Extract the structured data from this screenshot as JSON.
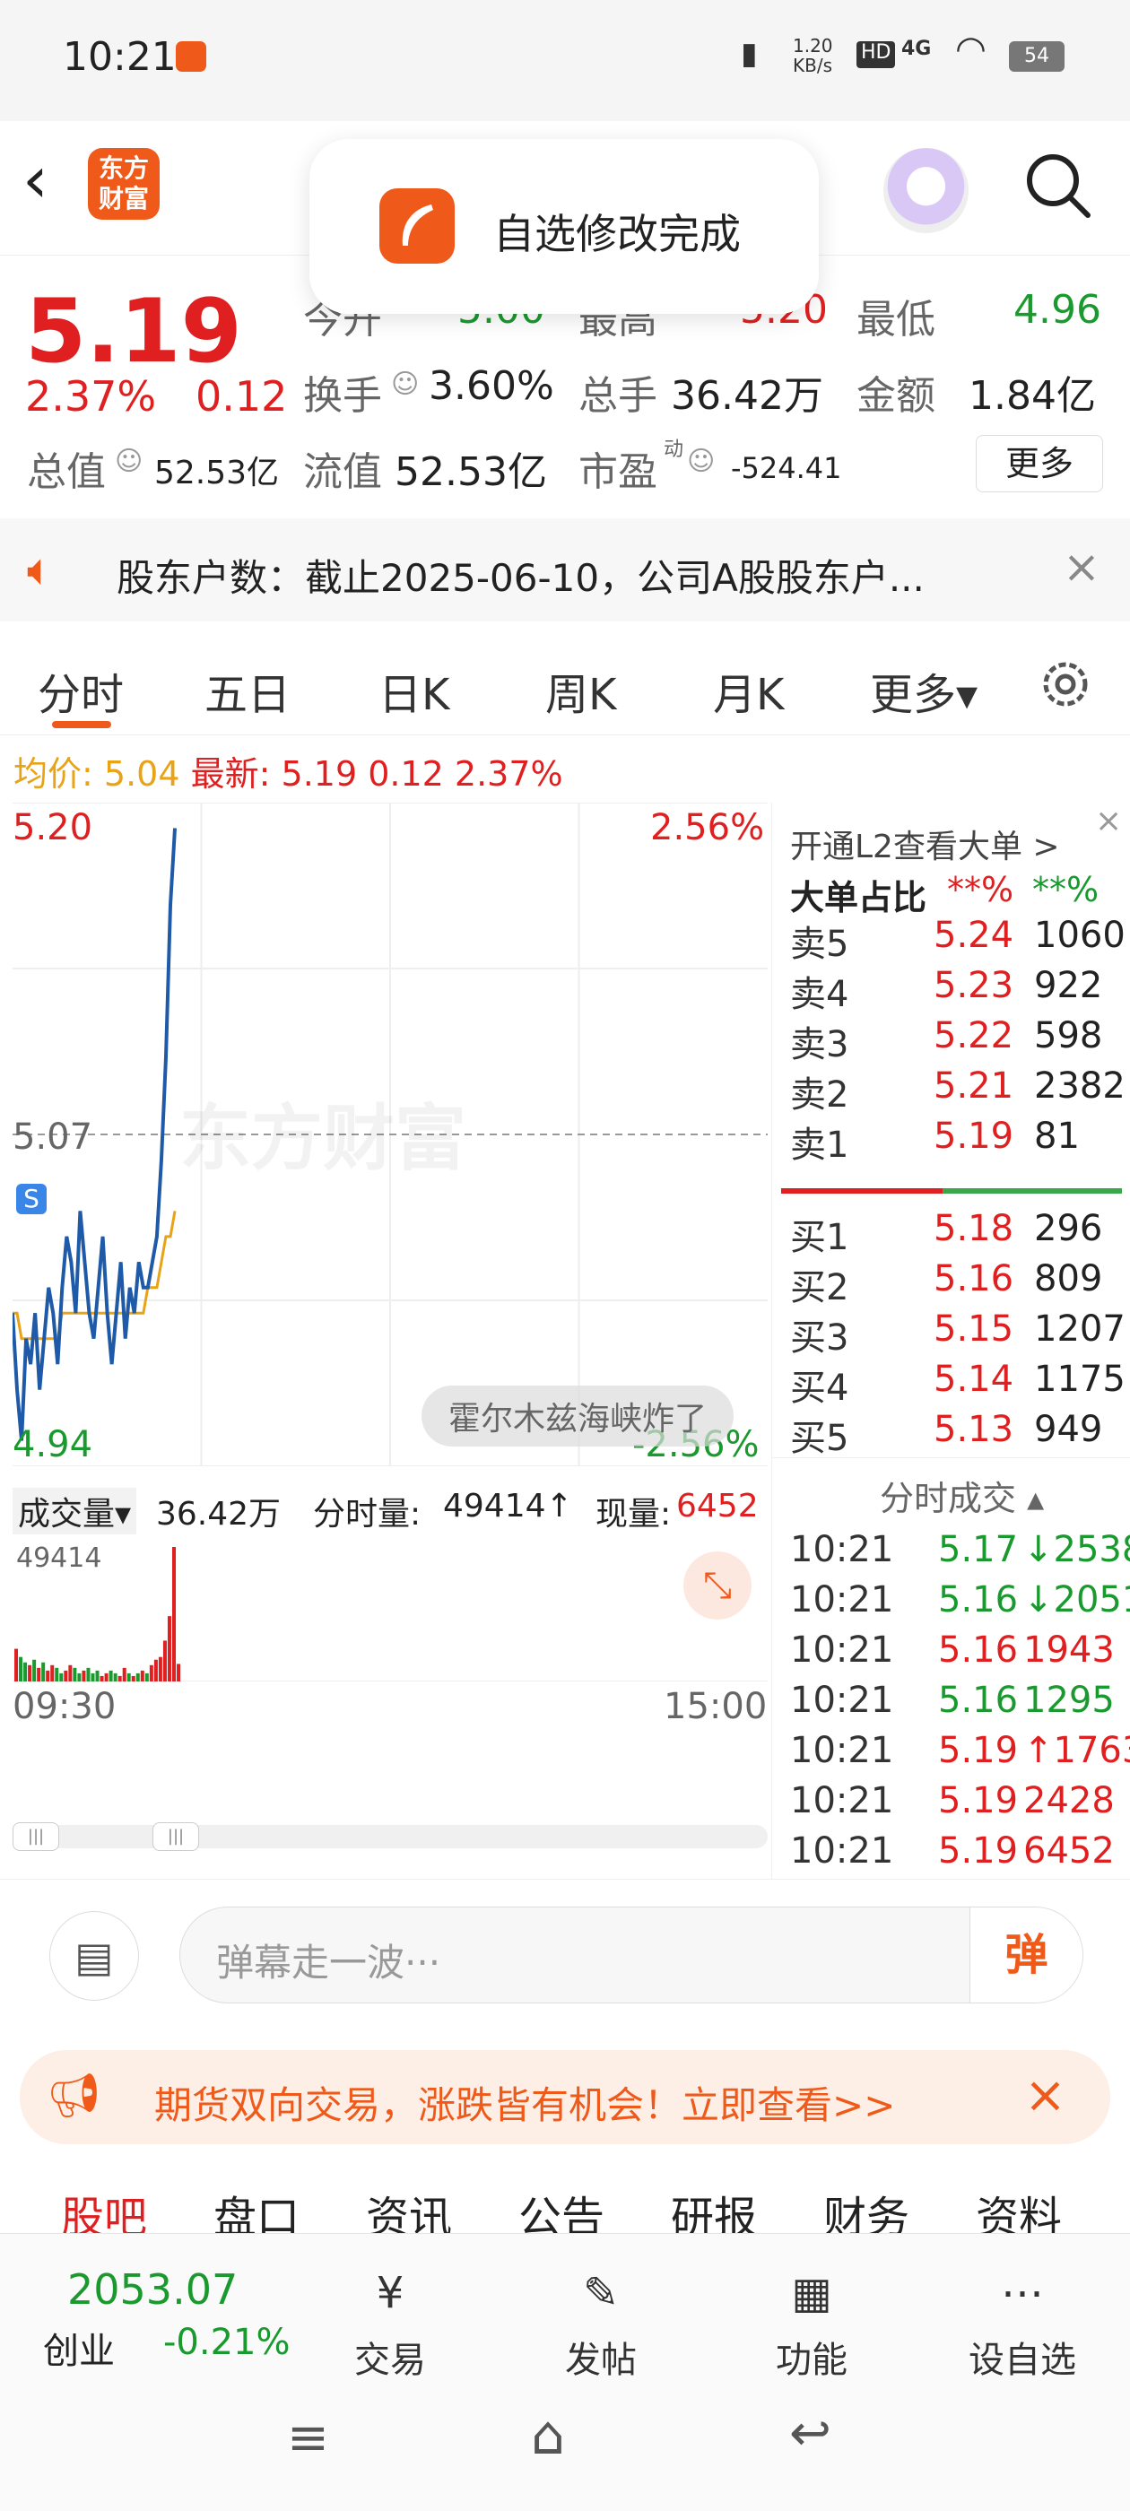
{
  "status": {
    "time": "10:21",
    "speed": "1.20\nKB/s",
    "net": "4G",
    "battery": "54"
  },
  "header": {
    "logo": "东方财富"
  },
  "toast": {
    "text": "自选修改完成"
  },
  "quote": {
    "price": "5.19",
    "pct": "2.37%",
    "chg": "0.12",
    "open_label": "今开",
    "open": "5.00",
    "high_label": "最高",
    "high": "5.20",
    "low_label": "最低",
    "low": "4.96",
    "turnover_label": "换手",
    "turnover": "3.60%",
    "vol_label": "总手",
    "vol": "36.42万",
    "amount_label": "金额",
    "amount": "1.84亿",
    "mcap_label": "总值",
    "mcap": "52.53亿",
    "float_label": "流值",
    "float": "52.53亿",
    "pe_label": "市盈",
    "pe_sup": "动",
    "pe": "-524.41",
    "more": "更多"
  },
  "notice": {
    "text": "股东户数：截止2025-06-10，公司A股股东户..."
  },
  "tabs": [
    {
      "label": "分时"
    },
    {
      "label": "五日"
    },
    {
      "label": "日K"
    },
    {
      "label": "周K"
    },
    {
      "label": "月K"
    },
    {
      "label": "更多▾"
    }
  ],
  "infoline": {
    "avg_label": "均价:",
    "avg": "5.04",
    "last_label": "最新:",
    "last": "5.19",
    "chg": "0.12",
    "pct": "2.37%"
  },
  "chart": {
    "top": "5.20",
    "top_pct": "2.56%",
    "mid": "5.07",
    "bot": "4.94",
    "bot_pct": "-2.56%",
    "watermark": "东方财富",
    "bubble": "霍尔木兹海峡炸了",
    "marker": "S"
  },
  "volume": {
    "label": "成交量▾",
    "total": "36.42万",
    "fs_label": "分时量:",
    "fs": "49414↑",
    "now_label": "现量:",
    "now": "6452",
    "max": "49414",
    "start": "09:30",
    "end": "15:00"
  },
  "chart_data": {
    "type": "line",
    "x": [
      "09:30",
      "09:31",
      "09:32",
      "09:33",
      "09:34",
      "09:35",
      "09:36",
      "09:37",
      "09:38",
      "09:39",
      "09:40",
      "09:41",
      "09:42",
      "09:43",
      "09:44",
      "09:45",
      "09:46",
      "09:47",
      "09:48",
      "09:49",
      "09:50",
      "09:51",
      "09:52",
      "09:53",
      "09:54",
      "09:55",
      "09:56",
      "09:57",
      "09:58",
      "09:59",
      "10:00",
      "10:05",
      "10:10",
      "10:15",
      "10:18",
      "10:20",
      "10:21"
    ],
    "series": [
      {
        "values": [
          5.0,
          4.97,
          4.95,
          4.99,
          4.98,
          5.0,
          4.97,
          4.99,
          5.01,
          5.0,
          4.98,
          5.01,
          5.03,
          5.02,
          5.0,
          5.04,
          5.02,
          5.0,
          4.99,
          5.01,
          5.03,
          5.0,
          4.98,
          5.0,
          5.02,
          4.99,
          5.01,
          5.0,
          5.02,
          5.01,
          5.01,
          5.02,
          5.03,
          5.06,
          5.1,
          5.16,
          5.19
        ]
      },
      {
        "values": [
          5.0,
          5.0,
          4.99,
          4.99,
          4.99,
          4.99,
          4.99,
          4.99,
          4.99,
          4.99,
          4.99,
          5.0,
          5.0,
          5.0,
          5.0,
          5.0,
          5.0,
          5.0,
          5.0,
          5.0,
          5.0,
          5.0,
          5.0,
          5.0,
          5.0,
          5.0,
          5.0,
          5.0,
          5.0,
          5.0,
          5.01,
          5.01,
          5.01,
          5.02,
          5.03,
          5.03,
          5.04
        ]
      }
    ],
    "ylim": [
      4.94,
      5.2
    ],
    "volumes": [
      12000,
      9000,
      7000,
      6000,
      8000,
      5000,
      7000,
      4000,
      6000,
      5000,
      3000,
      4000,
      6000,
      5000,
      3000,
      4000,
      5000,
      3000,
      4000,
      2000,
      3000,
      4000,
      3000,
      2000,
      5000,
      3000,
      2000,
      3000,
      4000,
      3000,
      6000,
      8000,
      9000,
      15000,
      24000,
      49414,
      6452
    ]
  },
  "orderbook": {
    "l2": "开通L2查看大单 >",
    "big_label": "大单占比",
    "big_sell": "**%",
    "big_buy": "**%",
    "asks": [
      {
        "l": "卖5",
        "p": "5.24",
        "v": "1060"
      },
      {
        "l": "卖4",
        "p": "5.23",
        "v": "922"
      },
      {
        "l": "卖3",
        "p": "5.22",
        "v": "598"
      },
      {
        "l": "卖2",
        "p": "5.21",
        "v": "2382"
      },
      {
        "l": "卖1",
        "p": "5.19",
        "v": "81"
      }
    ],
    "bids": [
      {
        "l": "买1",
        "p": "5.18",
        "v": "296"
      },
      {
        "l": "买2",
        "p": "5.16",
        "v": "809"
      },
      {
        "l": "买3",
        "p": "5.15",
        "v": "1207"
      },
      {
        "l": "买4",
        "p": "5.14",
        "v": "1175"
      },
      {
        "l": "买5",
        "p": "5.13",
        "v": "949"
      }
    ],
    "ticks_label": "分时成交 ▴",
    "ticks": [
      {
        "t": "10:21",
        "p": "5.17",
        "v": "↓2538",
        "c": "g"
      },
      {
        "t": "10:21",
        "p": "5.16",
        "v": "↓2051",
        "c": "g"
      },
      {
        "t": "10:21",
        "p": "5.16",
        "v": "1943",
        "c": "r"
      },
      {
        "t": "10:21",
        "p": "5.16",
        "v": "1295",
        "c": "g"
      },
      {
        "t": "10:21",
        "p": "5.19",
        "v": "↑1763",
        "c": "r"
      },
      {
        "t": "10:21",
        "p": "5.19",
        "v": "2428",
        "c": "r"
      },
      {
        "t": "10:21",
        "p": "5.19",
        "v": "6452",
        "c": "r"
      }
    ]
  },
  "comment": {
    "placeholder": "弹幕走一波···",
    "send": "弹"
  },
  "ad": {
    "text": "期货双向交易，涨跌皆有机会！立即查看>>"
  },
  "subtabs": [
    {
      "label": "股吧"
    },
    {
      "label": "盘口"
    },
    {
      "label": "资讯"
    },
    {
      "label": "公告"
    },
    {
      "label": "研报"
    },
    {
      "label": "财务"
    },
    {
      "label": "资料"
    }
  ],
  "index": {
    "value": "2053.07",
    "name": "创业",
    "pct": "-0.21%"
  },
  "nav": [
    {
      "label": "交易",
      "icon": "¥"
    },
    {
      "label": "发帖",
      "icon": "✎"
    },
    {
      "label": "功能",
      "icon": "▦"
    },
    {
      "label": "设自选",
      "icon": "⋯"
    }
  ],
  "colors": {
    "accent": "#ef5a1a",
    "up": "#e02020",
    "down": "#1a9a2e",
    "line": "#1e5aa8",
    "avg": "#e8a317"
  }
}
